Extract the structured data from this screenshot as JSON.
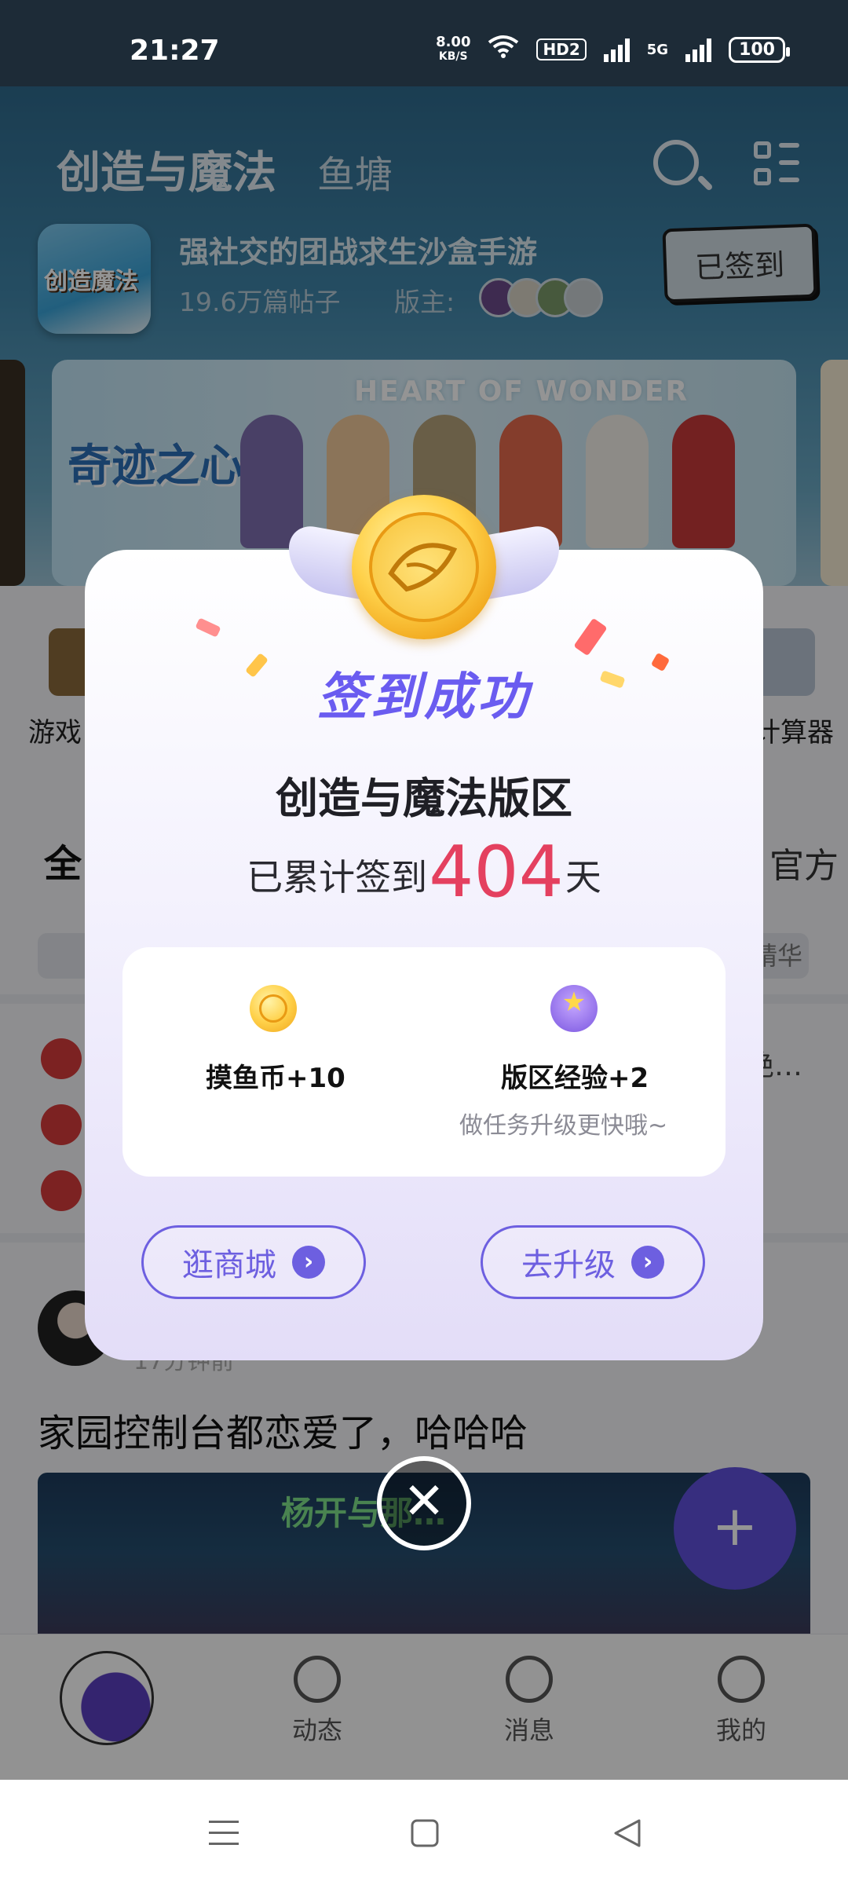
{
  "status_bar": {
    "time": "21:27",
    "net_speed": "8.00",
    "net_unit": "KB/S",
    "hd": "HD2",
    "signal_5g": "5G",
    "battery": "100"
  },
  "header": {
    "tab_main": "创造与魔法",
    "tab_sub": "鱼塘"
  },
  "forum": {
    "tagline": "强社交的团战求生沙盒手游",
    "post_count": "19.6万篇帖子",
    "moderator_label": "版主:",
    "checked_in_label": "已签到"
  },
  "banner": {
    "heading": "HEART OF WONDER",
    "title": "奇迹之心"
  },
  "quick_links": {
    "left": "游戏",
    "right": "计算器"
  },
  "feed": {
    "tab_all": "全",
    "tab_official": "官方",
    "tag_right": "精华",
    "pinned_tail": "绝…"
  },
  "post": {
    "meta": "17分钟前",
    "title": "家园控制台都恋爱了，哈哈哈"
  },
  "bottom_nav": {
    "dynamic": "动态",
    "messages": "消息",
    "mine": "我的"
  },
  "fab": {
    "label": "+"
  },
  "dialog": {
    "title": "签到成功",
    "zone_name": "创造与魔法版区",
    "streak_prefix": "已累计签到",
    "streak_days": "404",
    "streak_suffix": "天",
    "reward_coin": "摸鱼币+10",
    "reward_exp": "版区经验+2",
    "reward_exp_hint": "做任务升级更快哦~",
    "btn_shop": "逛商城",
    "btn_upgrade": "去升级",
    "close_label": "✕"
  },
  "colors": {
    "accent": "#6d5fe0",
    "streak_number": "#e4405f",
    "title_purple": "#6a5cf0"
  }
}
